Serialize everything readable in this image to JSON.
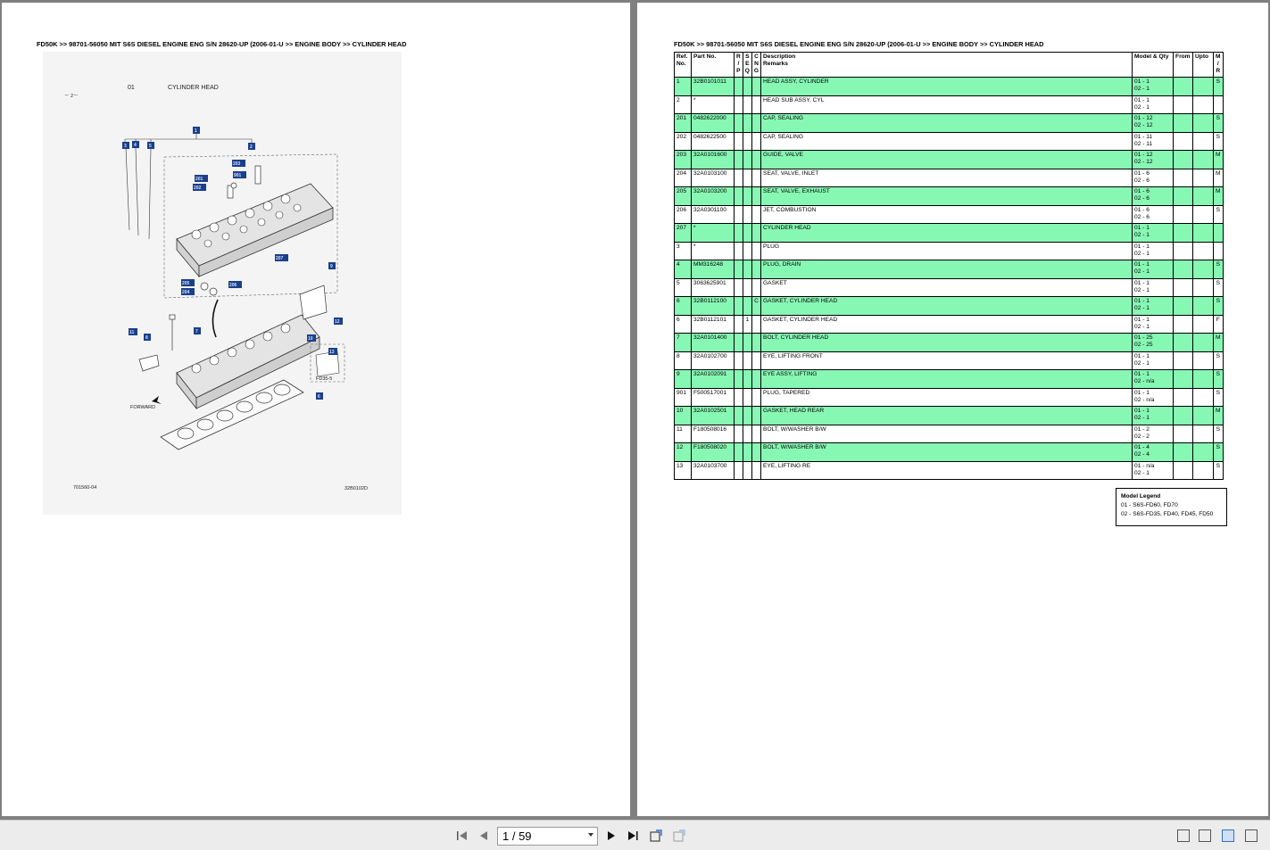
{
  "breadcrumb": "FD50K >> 98701-56050 MIT S6S DIESEL ENGINE ENG S/N 28620-UP (2006-01-U >> ENGINE BODY >> CYLINDER HEAD",
  "drawing": {
    "group_number": "01",
    "group_title": "CYLINDER HEAD",
    "page_mark": "－ 2－",
    "forward_label": "FORWARD",
    "variant_label": "FD35-5",
    "drawing_number": "701560-04",
    "part_code": "32B0102D",
    "callouts": [
      "1",
      "2",
      "3",
      "4",
      "5",
      "6",
      "7",
      "8",
      "9",
      "10",
      "11",
      "12",
      "13",
      "201",
      "202",
      "203",
      "204",
      "205",
      "206",
      "207",
      "901"
    ]
  },
  "table": {
    "headers": {
      "ref": "Ref.\nNo.",
      "part": "Part No.",
      "rp": "R\n/\nP",
      "seq": "S\nE\nQ",
      "cng": "C\nN\nG",
      "desc": "Description\nRemarks",
      "qty": "Model & Qty",
      "from": "From",
      "upto": "Upto",
      "mr": "M\n/\nR"
    },
    "rows": [
      {
        "ref": "1",
        "part": "32B0101011",
        "rp": "",
        "seq": "",
        "cng": "",
        "desc": "HEAD ASSY, CYLINDER",
        "qty": "01 - 1\n02 - 1",
        "mr": "S",
        "green": true
      },
      {
        "ref": "2",
        "part": "*",
        "rp": "",
        "seq": "",
        "cng": "",
        "desc": "HEAD SUB ASSY, CYL",
        "qty": "01 - 1\n02 - 1",
        "mr": "",
        "green": false
      },
      {
        "ref": "201",
        "part": "0482622000",
        "rp": "",
        "seq": "",
        "cng": "",
        "desc": "CAP, SEALING",
        "qty": "01 - 12\n02 - 12",
        "mr": "S",
        "green": true
      },
      {
        "ref": "202",
        "part": "0482622500",
        "rp": "",
        "seq": "",
        "cng": "",
        "desc": "CAP, SEALING",
        "qty": "01 - 11\n02 - 11",
        "mr": "S",
        "green": false
      },
      {
        "ref": "203",
        "part": "32A0101600",
        "rp": "",
        "seq": "",
        "cng": "",
        "desc": "GUIDE, VALVE",
        "qty": "01 - 12\n02 - 12",
        "mr": "M",
        "green": true
      },
      {
        "ref": "204",
        "part": "32A0103100",
        "rp": "",
        "seq": "",
        "cng": "",
        "desc": "SEAT, VALVE, INLET",
        "qty": "01 - 6\n02 - 6",
        "mr": "M",
        "green": false
      },
      {
        "ref": "205",
        "part": "32A0103200",
        "rp": "",
        "seq": "",
        "cng": "",
        "desc": "SEAT, VALVE, EXHAUST",
        "qty": "01 - 6\n02 - 6",
        "mr": "M",
        "green": true
      },
      {
        "ref": "206",
        "part": "32A0301100",
        "rp": "",
        "seq": "",
        "cng": "",
        "desc": "JET, COMBUSTION",
        "qty": "01 - 6\n02 - 6",
        "mr": "S",
        "green": false
      },
      {
        "ref": "207",
        "part": "*",
        "rp": "",
        "seq": "",
        "cng": "",
        "desc": "CYLINDER HEAD",
        "qty": "01 - 1\n02 - 1",
        "mr": "",
        "green": true
      },
      {
        "ref": "3",
        "part": "*",
        "rp": "",
        "seq": "",
        "cng": "",
        "desc": "PLUG",
        "qty": "01 - 1\n02 - 1",
        "mr": "",
        "green": false
      },
      {
        "ref": "4",
        "part": "MM316248",
        "rp": "",
        "seq": "",
        "cng": "",
        "desc": "PLUG, DRAIN",
        "qty": "01 - 1\n02 - 1",
        "mr": "S",
        "green": true
      },
      {
        "ref": "5",
        "part": "3063625901",
        "rp": "",
        "seq": "",
        "cng": "",
        "desc": "GASKET",
        "qty": "01 - 1\n02 - 1",
        "mr": "S",
        "green": false
      },
      {
        "ref": "6",
        "part": "32B0112100",
        "rp": "",
        "seq": "",
        "cng": "C",
        "desc": "GASKET, CYLINDER HEAD",
        "qty": "01 - 1\n02 - 1",
        "mr": "S",
        "green": true
      },
      {
        "ref": "6",
        "part": "32B0112101",
        "rp": "",
        "seq": "1",
        "cng": "",
        "desc": "GASKET, CYLINDER HEAD",
        "qty": "01 - 1\n02 - 1",
        "mr": "F",
        "green": false
      },
      {
        "ref": "7",
        "part": "32A0101400",
        "rp": "",
        "seq": "",
        "cng": "",
        "desc": "BOLT, CYLINDER HEAD",
        "qty": "01 - 25\n02 - 25",
        "mr": "M",
        "green": true
      },
      {
        "ref": "8",
        "part": "32A0102700",
        "rp": "",
        "seq": "",
        "cng": "",
        "desc": "EYE, LIFTING FRONT",
        "qty": "01 - 1\n02 - 1",
        "mr": "S",
        "green": false
      },
      {
        "ref": "9",
        "part": "32A0102091",
        "rp": "",
        "seq": "",
        "cng": "",
        "desc": "EYE ASSY, LIFTING",
        "qty": "01 - 1\n02 - n/a",
        "mr": "S",
        "green": true
      },
      {
        "ref": "901",
        "part": "F500517001",
        "rp": "",
        "seq": "",
        "cng": "",
        "desc": "PLUG, TAPERED",
        "qty": "01 - 1\n02 - n/a",
        "mr": "S",
        "green": false
      },
      {
        "ref": "10",
        "part": "32A0102501",
        "rp": "",
        "seq": "",
        "cng": "",
        "desc": "GASKET, HEAD REAR",
        "qty": "01 - 1\n02 - 1",
        "mr": "M",
        "green": true
      },
      {
        "ref": "11",
        "part": "F180508016",
        "rp": "",
        "seq": "",
        "cng": "",
        "desc": "BOLT, W/WASHER B/W",
        "qty": "01 - 2\n02 - 2",
        "mr": "S",
        "green": false
      },
      {
        "ref": "12",
        "part": "F180508020",
        "rp": "",
        "seq": "",
        "cng": "",
        "desc": "BOLT, W/WASHER B/W",
        "qty": "01 - 4\n02 - 4",
        "mr": "S",
        "green": true
      },
      {
        "ref": "13",
        "part": "32A0103700",
        "rp": "",
        "seq": "",
        "cng": "",
        "desc": "EYE, LIFTING RE",
        "qty": "01 - n/a\n02 - 1",
        "mr": "S",
        "green": false
      }
    ]
  },
  "legend": {
    "title": "Model Legend",
    "lines": [
      "01 - S6S-FD60, FD70",
      "02 - S6S-FD35, FD40, FD45, FD50"
    ]
  },
  "toolbar": {
    "page_indicator": "1 / 59",
    "icons": [
      "first-page-icon",
      "prev-page-icon",
      "next-page-icon",
      "last-page-icon",
      "rotate-view-icon",
      "fit-page-icon",
      "single-page-icon",
      "continuous-icon",
      "two-page-icon",
      "two-page-continuous-icon"
    ]
  },
  "colors": {
    "row_highlight": "#87f7b4",
    "callout_fill": "#1b3f8a",
    "viewer_background": "#808080"
  }
}
